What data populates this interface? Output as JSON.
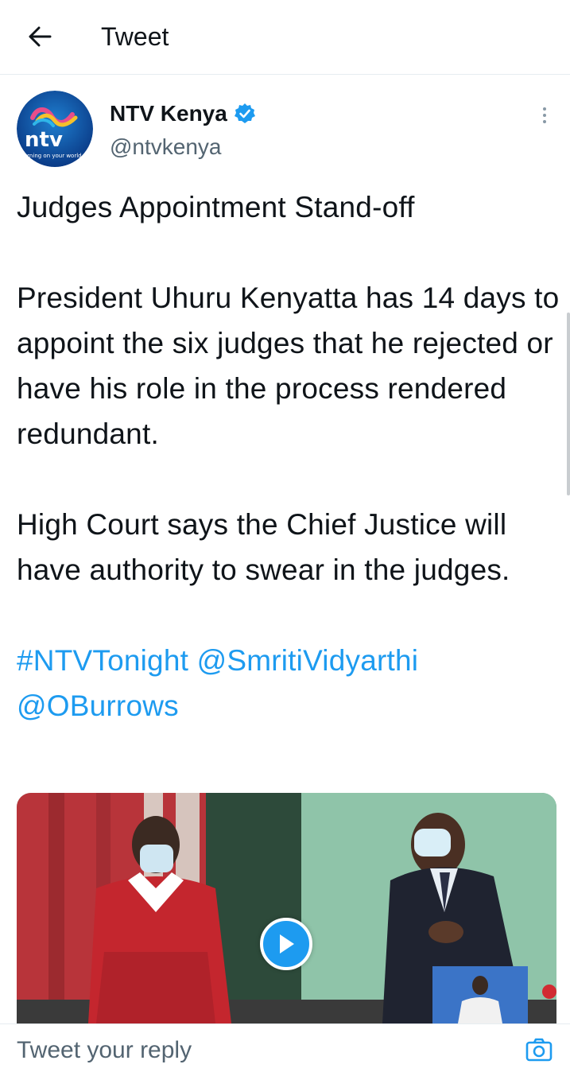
{
  "header": {
    "title": "Tweet",
    "back_icon": "arrow-left-icon"
  },
  "author": {
    "name": "NTV Kenya",
    "handle": "@ntvkenya",
    "verified": true,
    "avatar_text": "ntv",
    "avatar_tagline": "turning on your world"
  },
  "tweet": {
    "headline": "Judges Appointment Stand-off",
    "paragraph1": "President Uhuru Kenyatta has 14 days to appoint the six judges that he rejected or have his role in the process rendered redundant.",
    "paragraph2": "High Court says the Chief Justice will have authority to swear in the judges.",
    "hashtag": "#NTVTonight",
    "mention1": "@SmritiVidyarthi",
    "mention2": "@OBurrows"
  },
  "reply": {
    "placeholder": "Tweet your reply",
    "camera_icon": "camera-icon"
  },
  "colors": {
    "link": "#1d9bf0",
    "secondary_text": "#536471",
    "verified_badge": "#1d9bf0"
  }
}
